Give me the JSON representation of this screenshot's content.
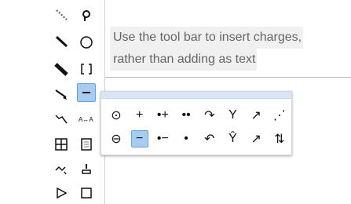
{
  "tooltip": {
    "line1": "Use the tool bar to insert charges,",
    "line2": "rather than adding as text"
  },
  "toolbar": {
    "tools": [
      {
        "name": "wavy-bond-icon"
      },
      {
        "name": "lasso-icon"
      },
      {
        "name": "single-bond-icon"
      },
      {
        "name": "ring-icon"
      },
      {
        "name": "bold-bond-icon"
      },
      {
        "name": "bracket-icon"
      },
      {
        "name": "hash-bond-icon"
      },
      {
        "name": "charge-tool-icon"
      },
      {
        "name": "reaction-arrow-icon"
      },
      {
        "name": "atom-atom-mapping-icon"
      },
      {
        "name": "table-icon"
      },
      {
        "name": "template-icon"
      },
      {
        "name": "curved-arrow-icon"
      },
      {
        "name": "stamp-icon"
      },
      {
        "name": "triangle-icon"
      },
      {
        "name": "square-icon"
      }
    ]
  },
  "charge_popup": {
    "row1": [
      {
        "label": "⊙"
      },
      {
        "label": "+"
      },
      {
        "label": "•+"
      },
      {
        "label": "••"
      },
      {
        "label": "↷"
      },
      {
        "label": "Y"
      },
      {
        "label": "↗"
      },
      {
        "label": "⋰"
      }
    ],
    "row2": [
      {
        "label": "⊖"
      },
      {
        "label": "−"
      },
      {
        "label": "•−"
      },
      {
        "label": "•"
      },
      {
        "label": "↶"
      },
      {
        "label": "Ŷ"
      },
      {
        "label": "↗"
      },
      {
        "label": "⇅"
      }
    ]
  }
}
